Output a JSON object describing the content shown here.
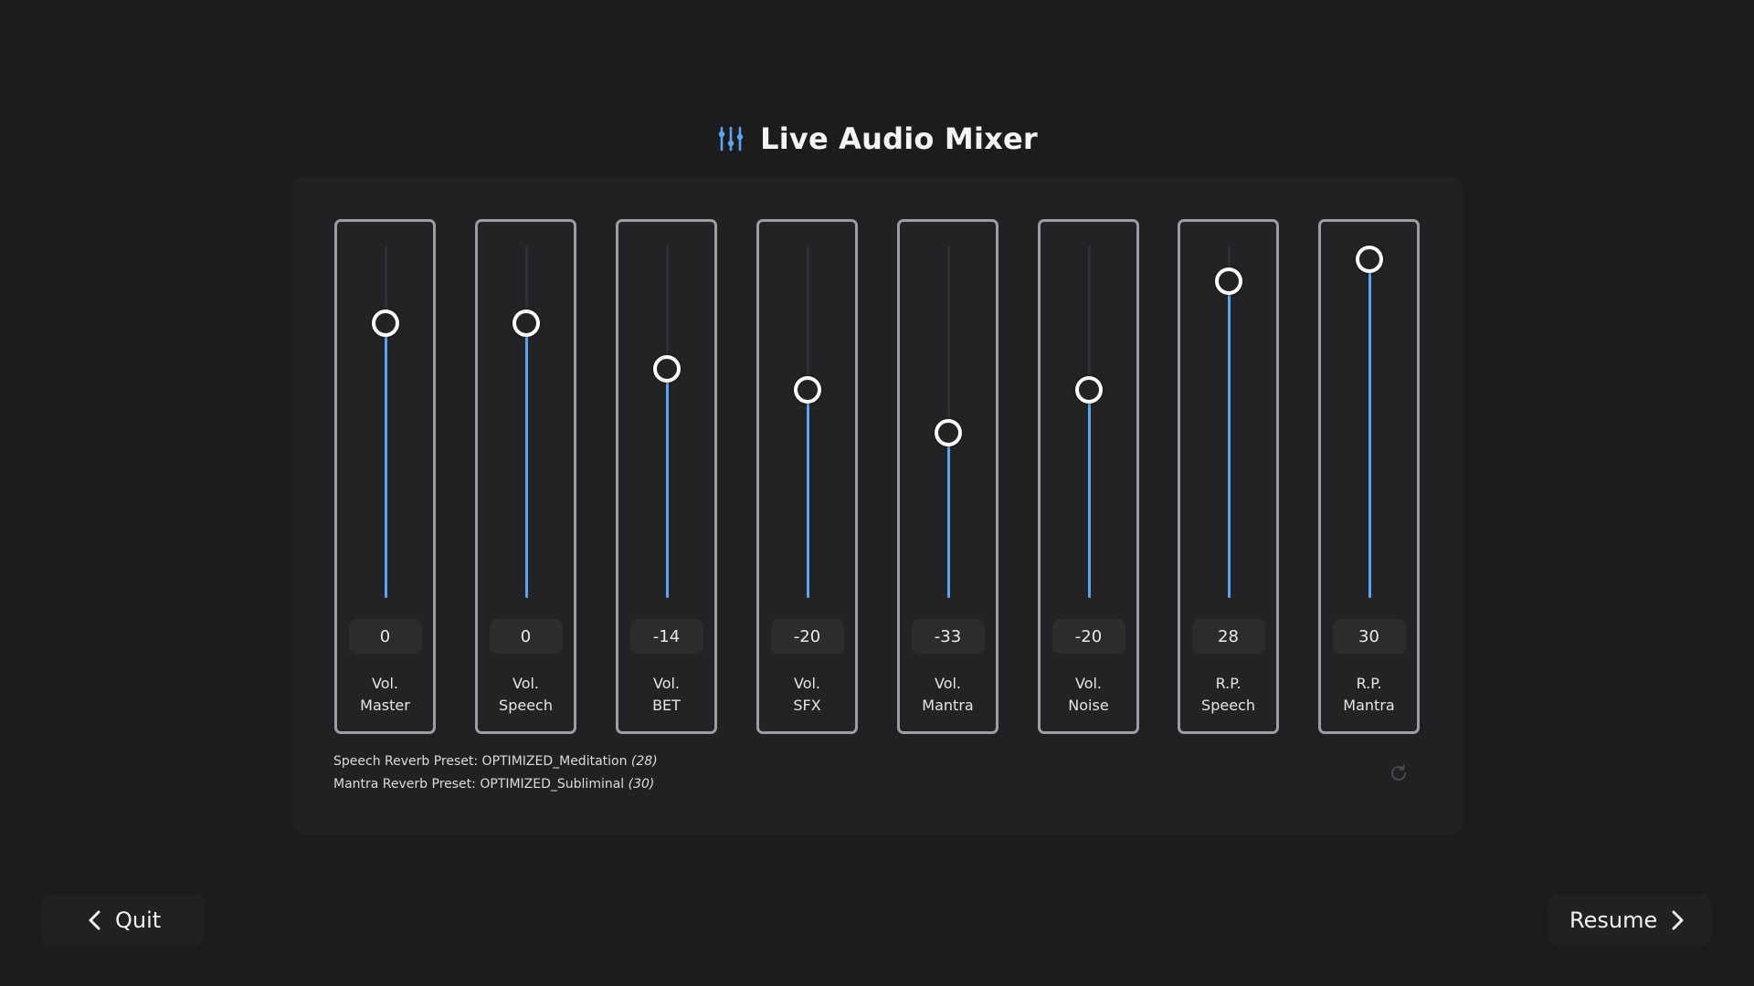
{
  "header": {
    "title": "Live Audio Mixer",
    "icon": "sliders-icon",
    "accent_color": "#58a6f0"
  },
  "channels": [
    {
      "line1": "Vol.",
      "line2": "Master",
      "value": "0",
      "level": 0.78
    },
    {
      "line1": "Vol.",
      "line2": "Speech",
      "value": "0",
      "level": 0.78
    },
    {
      "line1": "Vol.",
      "line2": "BET",
      "value": "-14",
      "level": 0.65
    },
    {
      "line1": "Vol.",
      "line2": "SFX",
      "value": "-20",
      "level": 0.59
    },
    {
      "line1": "Vol.",
      "line2": "Mantra",
      "value": "-33",
      "level": 0.47
    },
    {
      "line1": "Vol.",
      "line2": "Noise",
      "value": "-20",
      "level": 0.59
    },
    {
      "line1": "R.P.",
      "line2": "Speech",
      "value": "28",
      "level": 0.9
    },
    {
      "line1": "R.P.",
      "line2": "Mantra",
      "value": "30",
      "level": 0.96
    }
  ],
  "presets": {
    "speech_label": "Speech Reverb Preset: OPTIMIZED_Meditation",
    "speech_value": "(28)",
    "mantra_label": "Mantra Reverb Preset: OPTIMIZED_Subliminal",
    "mantra_value": "(30)"
  },
  "reset_icon": "refresh-icon",
  "nav": {
    "quit_label": "Quit",
    "quit_icon": "chevron-left-icon",
    "resume_label": "Resume",
    "resume_icon": "chevron-right-icon"
  }
}
